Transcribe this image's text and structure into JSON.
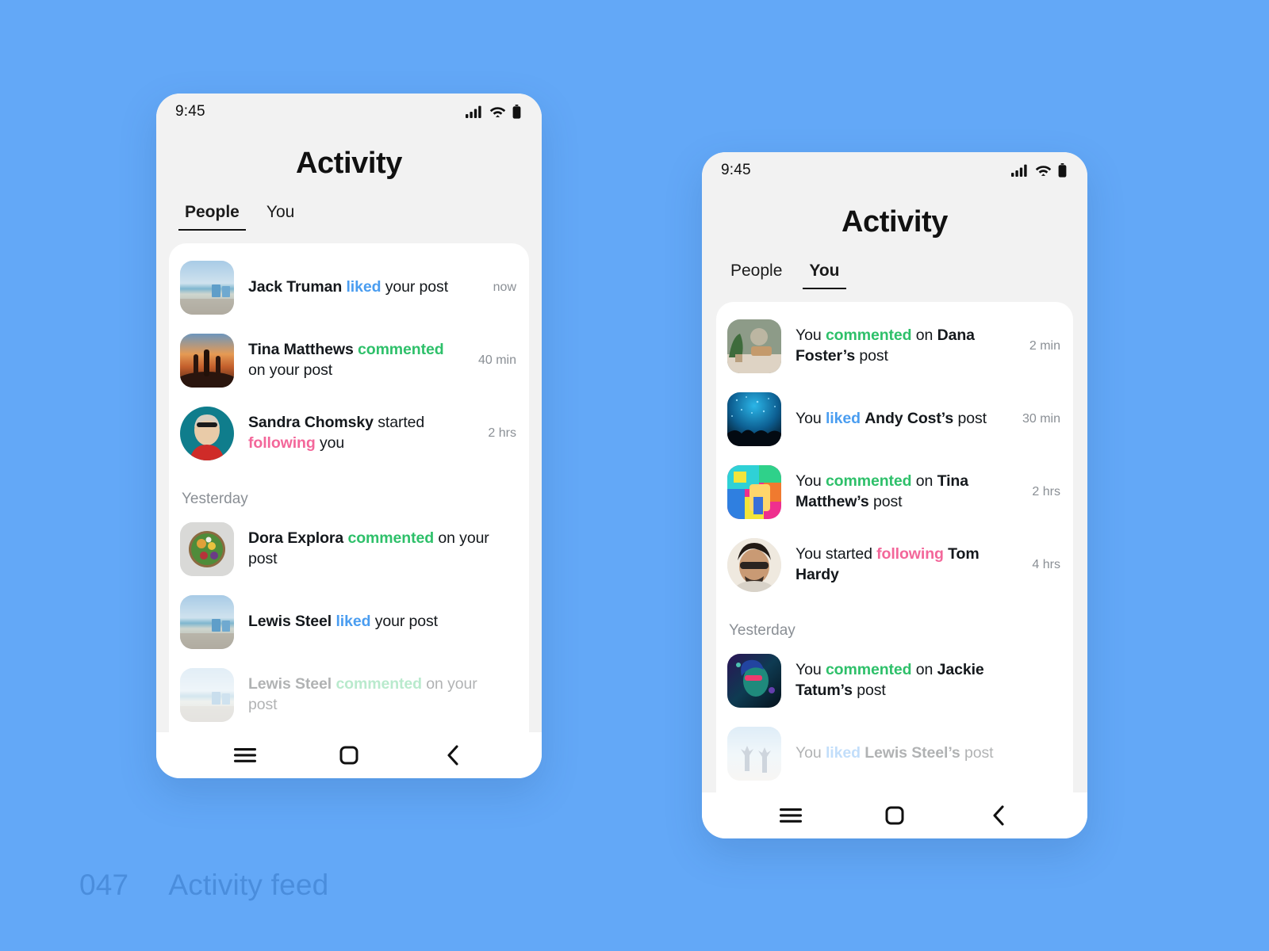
{
  "background_color": "#63a8f7",
  "caption": {
    "number": "047",
    "label": "Activity feed",
    "color": "#4a8ddc"
  },
  "accent_colors": {
    "liked": "#4a9df0",
    "commented": "#2ec06a",
    "following": "#f3679a",
    "timestamp": "#8a8f95"
  },
  "phones": [
    {
      "id": "phone-people",
      "status_bar": {
        "time": "9:45",
        "icons": [
          "cellular-signal-icon",
          "wifi-icon",
          "battery-icon"
        ]
      },
      "header": {
        "title": "Activity"
      },
      "tabs": [
        {
          "label": "People",
          "active": true
        },
        {
          "label": "You",
          "active": false
        }
      ],
      "sections": [
        {
          "label": null,
          "items": [
            {
              "thumb": "beach-chairs-photo",
              "thumb_shape": "rounded",
              "parts": [
                {
                  "text": "Jack Truman ",
                  "style": "bold"
                },
                {
                  "text": "liked",
                  "style": "liked"
                },
                {
                  "text": " your post",
                  "style": "normal"
                }
              ],
              "time": "now",
              "faded": false
            },
            {
              "thumb": "friends-sunset-photo",
              "thumb_shape": "rounded",
              "parts": [
                {
                  "text": "Tina Matthews ",
                  "style": "bold"
                },
                {
                  "text": "commented",
                  "style": "commented"
                },
                {
                  "text": " on your post",
                  "style": "normal"
                }
              ],
              "time": "40 min",
              "faded": false
            },
            {
              "thumb": "woman-teal-portrait",
              "thumb_shape": "round",
              "parts": [
                {
                  "text": "Sandra Chomsky ",
                  "style": "bold"
                },
                {
                  "text": "started ",
                  "style": "normal"
                },
                {
                  "text": "following",
                  "style": "following"
                },
                {
                  "text": " you",
                  "style": "normal"
                }
              ],
              "time": "2 hrs",
              "faded": false
            }
          ]
        },
        {
          "label": "Yesterday",
          "items": [
            {
              "thumb": "salad-bowl-photo",
              "thumb_shape": "rounded",
              "parts": [
                {
                  "text": "Dora Explora ",
                  "style": "bold"
                },
                {
                  "text": "commented",
                  "style": "commented"
                },
                {
                  "text": " on your post",
                  "style": "normal"
                }
              ],
              "time": "",
              "faded": false
            },
            {
              "thumb": "beach-chairs-photo",
              "thumb_shape": "rounded",
              "parts": [
                {
                  "text": "Lewis Steel ",
                  "style": "bold"
                },
                {
                  "text": "liked",
                  "style": "liked"
                },
                {
                  "text": " your post",
                  "style": "normal"
                }
              ],
              "time": "",
              "faded": false
            },
            {
              "thumb": "beach-chairs-photo",
              "thumb_shape": "rounded",
              "parts": [
                {
                  "text": "Lewis Steel ",
                  "style": "bold"
                },
                {
                  "text": "commented",
                  "style": "commented"
                },
                {
                  "text": " on your post",
                  "style": "normal"
                }
              ],
              "time": "",
              "faded": true
            }
          ]
        }
      ],
      "navbar": [
        "menu-icon",
        "home-icon",
        "back-icon"
      ]
    },
    {
      "id": "phone-you",
      "status_bar": {
        "time": "9:45",
        "icons": [
          "cellular-signal-icon",
          "wifi-icon",
          "battery-icon"
        ]
      },
      "header": {
        "title": "Activity"
      },
      "tabs": [
        {
          "label": "People",
          "active": false
        },
        {
          "label": "You",
          "active": true
        }
      ],
      "sections": [
        {
          "label": null,
          "items": [
            {
              "thumb": "living-room-photo",
              "thumb_shape": "rounded",
              "parts": [
                {
                  "text": "You ",
                  "style": "normal"
                },
                {
                  "text": "commented",
                  "style": "commented"
                },
                {
                  "text": " on ",
                  "style": "normal"
                },
                {
                  "text": "Dana Foster’s",
                  "style": "bold"
                },
                {
                  "text": " post",
                  "style": "normal"
                }
              ],
              "time": "2 min",
              "faded": false
            },
            {
              "thumb": "concert-crowd-photo",
              "thumb_shape": "rounded",
              "parts": [
                {
                  "text": "You ",
                  "style": "normal"
                },
                {
                  "text": "liked",
                  "style": "liked"
                },
                {
                  "text": " ",
                  "style": "normal"
                },
                {
                  "text": "Andy Cost’s",
                  "style": "bold"
                },
                {
                  "text": " post",
                  "style": "normal"
                }
              ],
              "time": "30 min",
              "faded": false
            },
            {
              "thumb": "colorful-wall-photo",
              "thumb_shape": "rounded",
              "parts": [
                {
                  "text": "You ",
                  "style": "normal"
                },
                {
                  "text": "commented",
                  "style": "commented"
                },
                {
                  "text": " on ",
                  "style": "normal"
                },
                {
                  "text": "Tina Matthew’s",
                  "style": "bold"
                },
                {
                  "text": " post",
                  "style": "normal"
                }
              ],
              "time": "2 hrs",
              "faded": false
            },
            {
              "thumb": "man-sunglasses-portrait",
              "thumb_shape": "round",
              "parts": [
                {
                  "text": "You started ",
                  "style": "normal"
                },
                {
                  "text": "following",
                  "style": "following"
                },
                {
                  "text": " ",
                  "style": "normal"
                },
                {
                  "text": "Tom Hardy",
                  "style": "bold"
                }
              ],
              "time": "4 hrs",
              "faded": false
            }
          ]
        },
        {
          "label": "Yesterday",
          "items": [
            {
              "thumb": "neon-portrait-photo",
              "thumb_shape": "rounded",
              "parts": [
                {
                  "text": "You ",
                  "style": "normal"
                },
                {
                  "text": "commented",
                  "style": "commented"
                },
                {
                  "text": " on ",
                  "style": "normal"
                },
                {
                  "text": "Jackie Tatum’s",
                  "style": "bold"
                },
                {
                  "text": " post",
                  "style": "normal"
                }
              ],
              "time": "",
              "faded": false
            },
            {
              "thumb": "beach-people-photo",
              "thumb_shape": "rounded",
              "parts": [
                {
                  "text": "You ",
                  "style": "normal"
                },
                {
                  "text": "liked",
                  "style": "liked"
                },
                {
                  "text": " ",
                  "style": "normal"
                },
                {
                  "text": "Lewis Steel’s",
                  "style": "bold"
                },
                {
                  "text": " post",
                  "style": "normal"
                }
              ],
              "time": "",
              "faded": true
            }
          ]
        }
      ],
      "navbar": [
        "menu-icon",
        "home-icon",
        "back-icon"
      ]
    }
  ]
}
